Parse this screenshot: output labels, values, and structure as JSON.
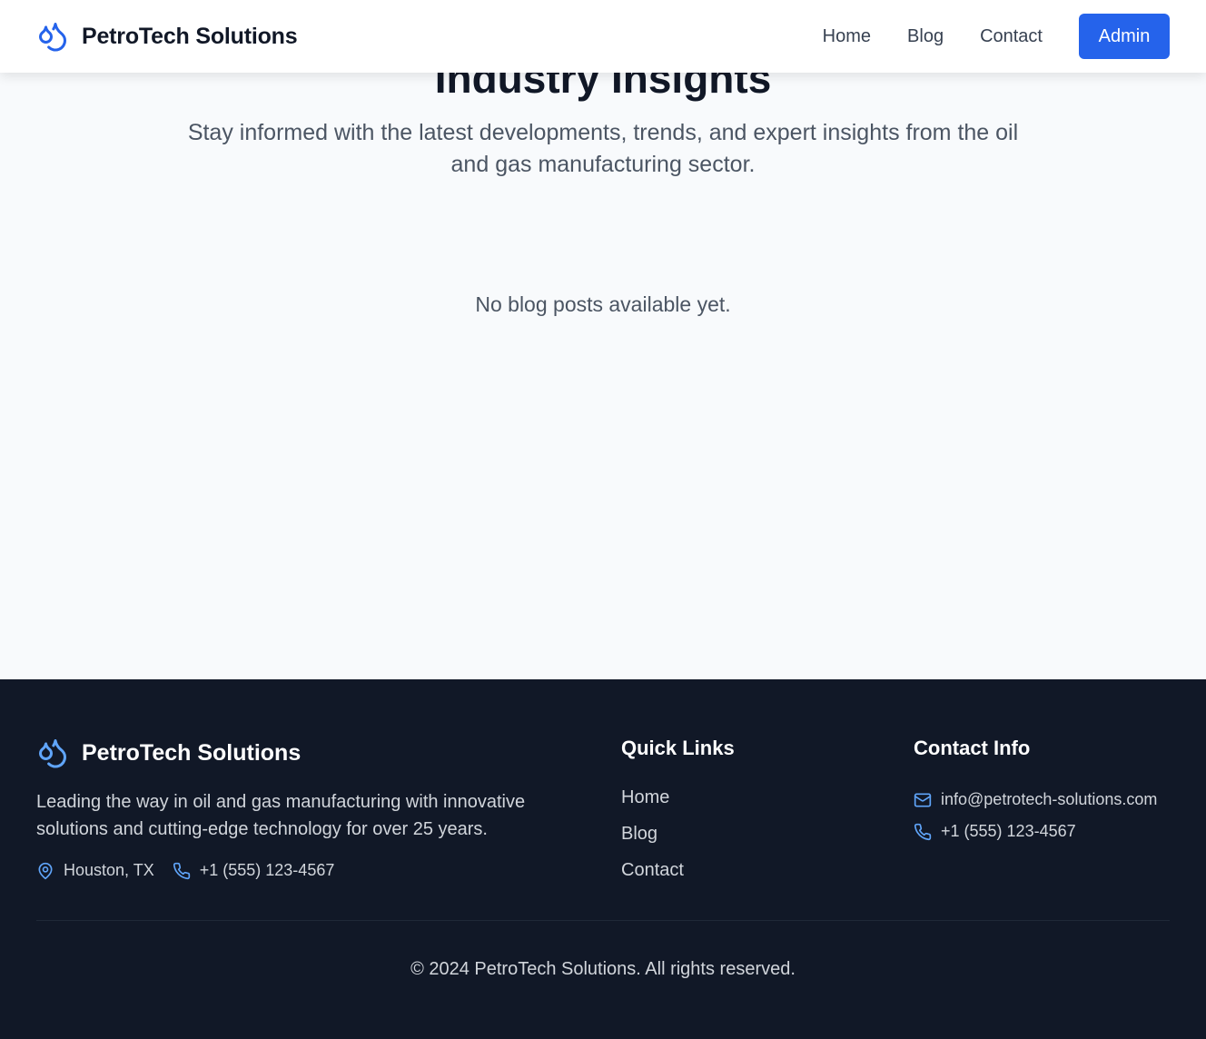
{
  "nav": {
    "brand": "PetroTech Solutions",
    "links": [
      "Home",
      "Blog",
      "Contact"
    ],
    "admin_label": "Admin"
  },
  "hero": {
    "title": "Industry Insights",
    "subtitle": "Stay informed with the latest developments, trends, and expert insights from the oil and gas manufacturing sector."
  },
  "blog": {
    "empty_message": "No blog posts available yet."
  },
  "footer": {
    "brand": "PetroTech Solutions",
    "description": "Leading the way in oil and gas manufacturing with innovative solutions and cutting-edge technology for over 25 years.",
    "location": "Houston, TX",
    "phone": "+1 (555) 123-4567",
    "quick_links": {
      "title": "Quick Links",
      "items": [
        "Home",
        "Blog",
        "Contact"
      ]
    },
    "contact_info": {
      "title": "Contact Info",
      "email": "info@petrotech-solutions.com",
      "phone": "+1 (555) 123-4567"
    },
    "copyright": "© 2024 PetroTech Solutions. All rights reserved."
  },
  "icons": {
    "logo": "droplets-icon",
    "location": "map-pin-icon",
    "phone": "phone-icon",
    "email": "mail-icon"
  },
  "colors": {
    "accent": "#2563eb",
    "icon_accent": "#3b82f6",
    "footer_bg": "#111827",
    "page_bg": "#f8fafc"
  }
}
